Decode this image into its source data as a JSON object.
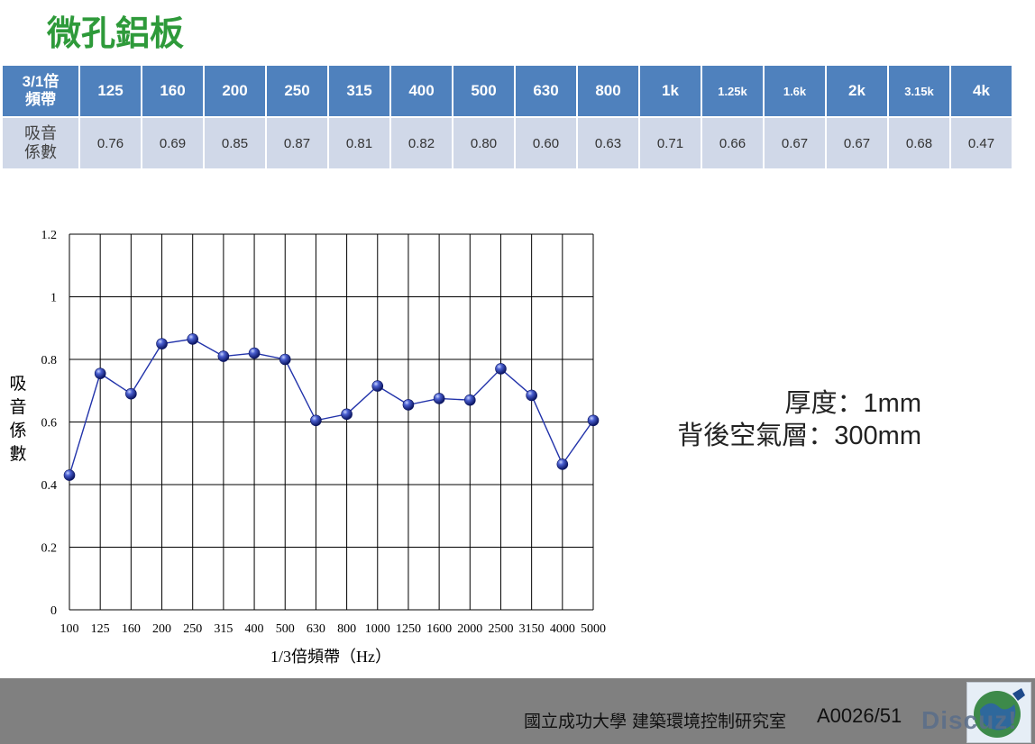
{
  "title": "微孔鋁板",
  "table": {
    "header_label": [
      "3/1倍",
      "頻帶"
    ],
    "value_label": [
      "吸音",
      "係數"
    ],
    "bands": [
      "125",
      "160",
      "200",
      "250",
      "315",
      "400",
      "500",
      "630",
      "800",
      "1k",
      "1.25k",
      "1.6k",
      "2k",
      "3.15k",
      "4k"
    ],
    "values": [
      "0.76",
      "0.69",
      "0.85",
      "0.87",
      "0.81",
      "0.82",
      "0.80",
      "0.60",
      "0.63",
      "0.71",
      "0.66",
      "0.67",
      "0.67",
      "0.68",
      "0.47"
    ]
  },
  "chart_data": {
    "type": "line",
    "x": [
      "100",
      "125",
      "160",
      "200",
      "250",
      "315",
      "400",
      "500",
      "630",
      "800",
      "1000",
      "1250",
      "1600",
      "2000",
      "2500",
      "3150",
      "4000",
      "5000"
    ],
    "values": [
      0.43,
      0.755,
      0.69,
      0.85,
      0.865,
      0.81,
      0.82,
      0.8,
      0.605,
      0.625,
      0.715,
      0.655,
      0.675,
      0.67,
      0.77,
      0.685,
      0.465,
      0.605
    ],
    "title": "",
    "xlabel": "1/3倍頻帶（Hz）",
    "ylabel": "吸音係數",
    "ylabel_chars": [
      "吸",
      "音",
      "係",
      "數"
    ],
    "ylim": [
      0,
      1.2
    ],
    "yticks": [
      "0",
      "0.2",
      "0.4",
      "0.6",
      "0.8",
      "1",
      "1.2"
    ],
    "grid": true,
    "line_color": "#2233aa",
    "marker_color": "#1c2e9a"
  },
  "info": {
    "thickness": "厚度：1mm",
    "air_layer": "背後空氣層：300mm"
  },
  "footer": {
    "institution": "國立成功大學  建築環境控制研究室",
    "page": "A0026/51",
    "watermark": "Discuz!"
  },
  "colors": {
    "title": "#2e9a3a",
    "header_bg": "#4f81bd",
    "row_bg": "#d0d8e8",
    "footer_bg": "#808080"
  }
}
